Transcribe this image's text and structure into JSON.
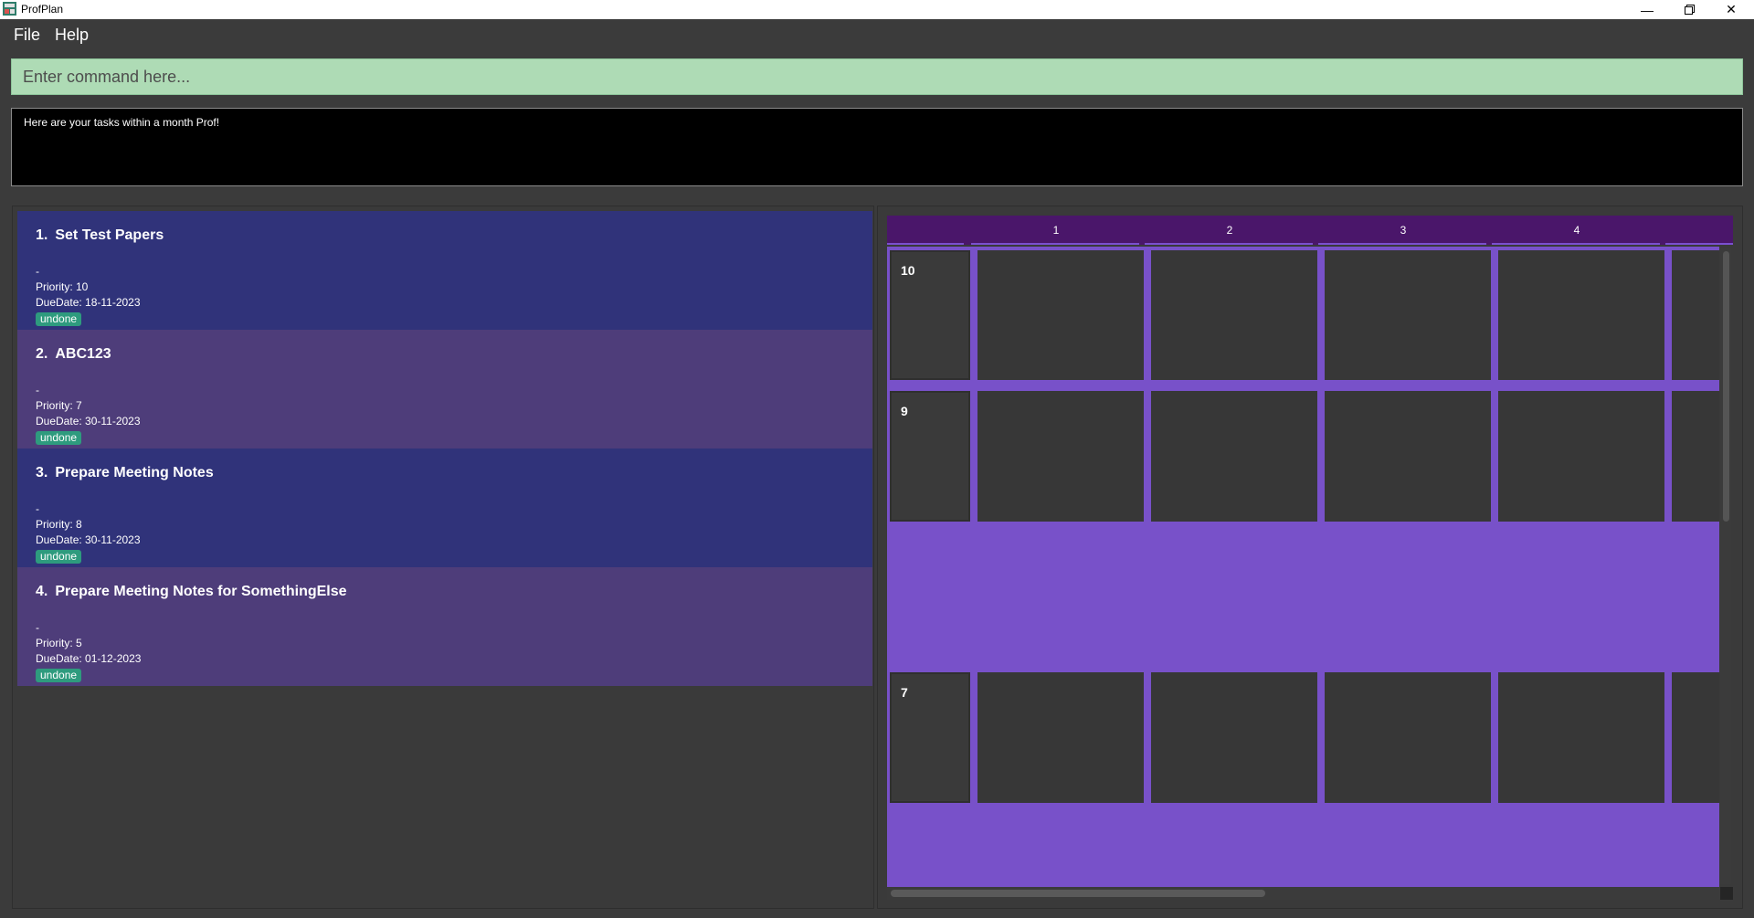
{
  "window": {
    "title": "ProfPlan"
  },
  "menu": {
    "file": "File",
    "help": "Help"
  },
  "command": {
    "placeholder": "Enter command here..."
  },
  "result": {
    "message": "Here are your tasks within a month Prof!"
  },
  "tasks": [
    {
      "num": "1.",
      "name": "Set Test Papers",
      "desc": "-",
      "priority": "Priority: 10",
      "due": "DueDate: 18-11-2023",
      "status": "undone"
    },
    {
      "num": "2.",
      "name": "ABC123",
      "desc": "-",
      "priority": "Priority: 7",
      "due": "DueDate: 30-11-2023",
      "status": "undone"
    },
    {
      "num": "3.",
      "name": "Prepare Meeting Notes",
      "desc": "-",
      "priority": "Priority: 8",
      "due": "DueDate: 30-11-2023",
      "status": "undone"
    },
    {
      "num": "4.",
      "name": "Prepare Meeting Notes for SomethingElse",
      "desc": "-",
      "priority": "Priority: 5",
      "due": "DueDate: 01-12-2023",
      "status": "undone"
    }
  ],
  "calendar": {
    "columns": [
      "1",
      "2",
      "3",
      "4"
    ],
    "rows": [
      "10",
      "9",
      "7"
    ]
  },
  "colors": {
    "command_bg": "#aedbb5",
    "task_odd": "#30337a",
    "task_even": "#4e3d7a",
    "badge": "#2e9b7e",
    "calendar_header": "#4a166a",
    "calendar_body": "#7851c9"
  },
  "icons": [
    "app-icon",
    "minimize-icon",
    "restore-icon",
    "close-icon"
  ]
}
